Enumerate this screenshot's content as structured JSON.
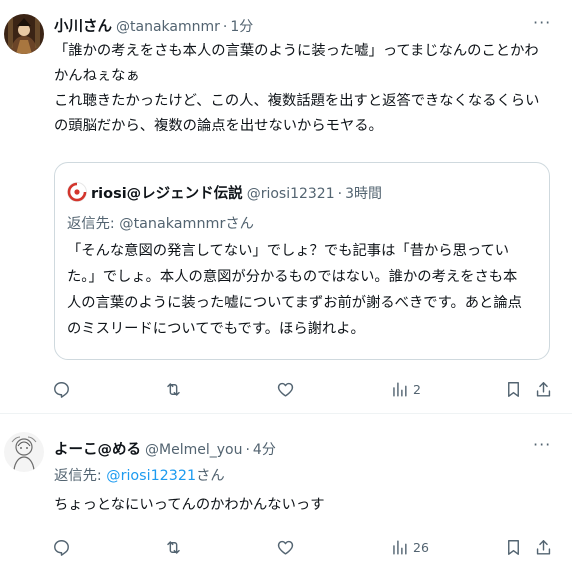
{
  "post1": {
    "author_name": "小川さん",
    "author_handle": "@tanakamnmr",
    "separator": "·",
    "time": "1分",
    "text": "「誰かの考えをさも本人の言葉のように装った嘘」ってまじなんのことかわ\nかんねぇなぁ\nこれ聴きたかったけど、この人、複数話題を出すと返答できなくなるくらい\nの頭脳だから、複数の論点を出せないからモヤる。",
    "quote": {
      "author_name": "riosi@レジェンド伝説",
      "author_handle": "@riosi12321",
      "separator": "·",
      "time": "3時間",
      "reply_prefix": "返信先:",
      "reply_handle": "@tanakamnmrさん",
      "text": "「そんな意図の発言してない」でしょ？でも記事は「昔から思ってい\nた。」でしょ。本人の意図が分かるものではない。誰かの考えをさも本\n人の言葉のように装った嘘についてまずお前が謝るべきです。あと論点\nのミスリードについてでもです。ほら謝れよ。"
    },
    "actions": {
      "reply_icon": "reply-icon",
      "retweet_icon": "retweet-icon",
      "like_icon": "heart-icon",
      "views_icon": "views-icon",
      "views_count": "2",
      "bookmark_icon": "bookmark-icon",
      "share_icon": "share-icon"
    }
  },
  "post2": {
    "author_name": "よーこ@める",
    "author_handle": "@Melmel_you",
    "separator": "·",
    "time": "4分",
    "reply_prefix": "返信先:",
    "reply_handle": "@riosi12321",
    "reply_suffix": "さん",
    "text": "ちょっとなにいってんのかわかんないっす",
    "actions": {
      "views_count": "26"
    }
  },
  "colors": {
    "text": "#0f1419",
    "secondary": "#536471",
    "link": "#1d9bf0",
    "border": "#cfd9de",
    "divider": "#eff3f4",
    "quote_logo": "#d3352c"
  }
}
